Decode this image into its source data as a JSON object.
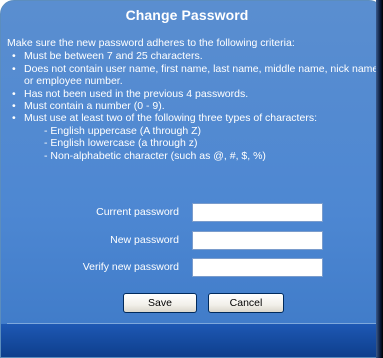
{
  "dialog": {
    "title": "Change Password",
    "intro": "Make sure the new password adheres to the following criteria:",
    "criteria": [
      "Must be between 7 and 25 characters.",
      "Does not contain user name, first name, last name, middle name, nick name or employee number.",
      "Has not been used in the previous 4 passwords.",
      "Must contain a number (0 - 9).",
      "Must use at least two of the following three types of characters:"
    ],
    "character_types": [
      "- English uppercase (A through Z)",
      "- English lowercase (a through z)",
      "- Non-alphabetic character (such as @, #, $, %)"
    ],
    "bullet": "•"
  },
  "form": {
    "current_password_label": "Current password",
    "current_password_value": "",
    "new_password_label": "New password",
    "new_password_value": "",
    "verify_password_label": "Verify new password",
    "verify_password_value": ""
  },
  "buttons": {
    "save_label": "Save",
    "cancel_label": "Cancel"
  },
  "colors": {
    "panel_blue": "#4d87d2",
    "footer_blue": "#1e58b4",
    "text": "#ffffff"
  }
}
